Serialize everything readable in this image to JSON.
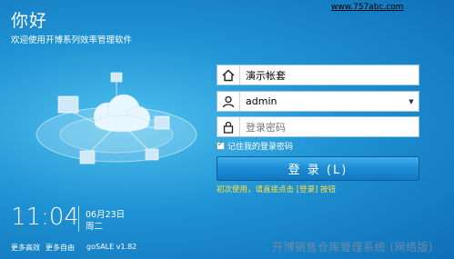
{
  "header": {
    "greeting": "你好",
    "welcome": "欢迎使用开博系列效率管理软件",
    "website": "www.757abc.com"
  },
  "login": {
    "account_value": "演示帐套",
    "username_value": "admin",
    "password_placeholder": "登录密码",
    "remember_label": "记住我的登录密码",
    "remember_checked": true,
    "login_button": "登 录 (L)",
    "hint": "初次使用，请直接点击 [登录] 按钮"
  },
  "clock": {
    "time": "11:04",
    "date": "06月23日",
    "weekday": "周二"
  },
  "footer": {
    "tagline1": "更多高效",
    "tagline2": "更多自由",
    "version": "goSALE v1.82",
    "product_name": "开博销售仓库管理系统 (网络版)"
  },
  "colors": {
    "background": "#1f93d4",
    "hint": "#ffe04a",
    "button": "#1d8bd3"
  }
}
